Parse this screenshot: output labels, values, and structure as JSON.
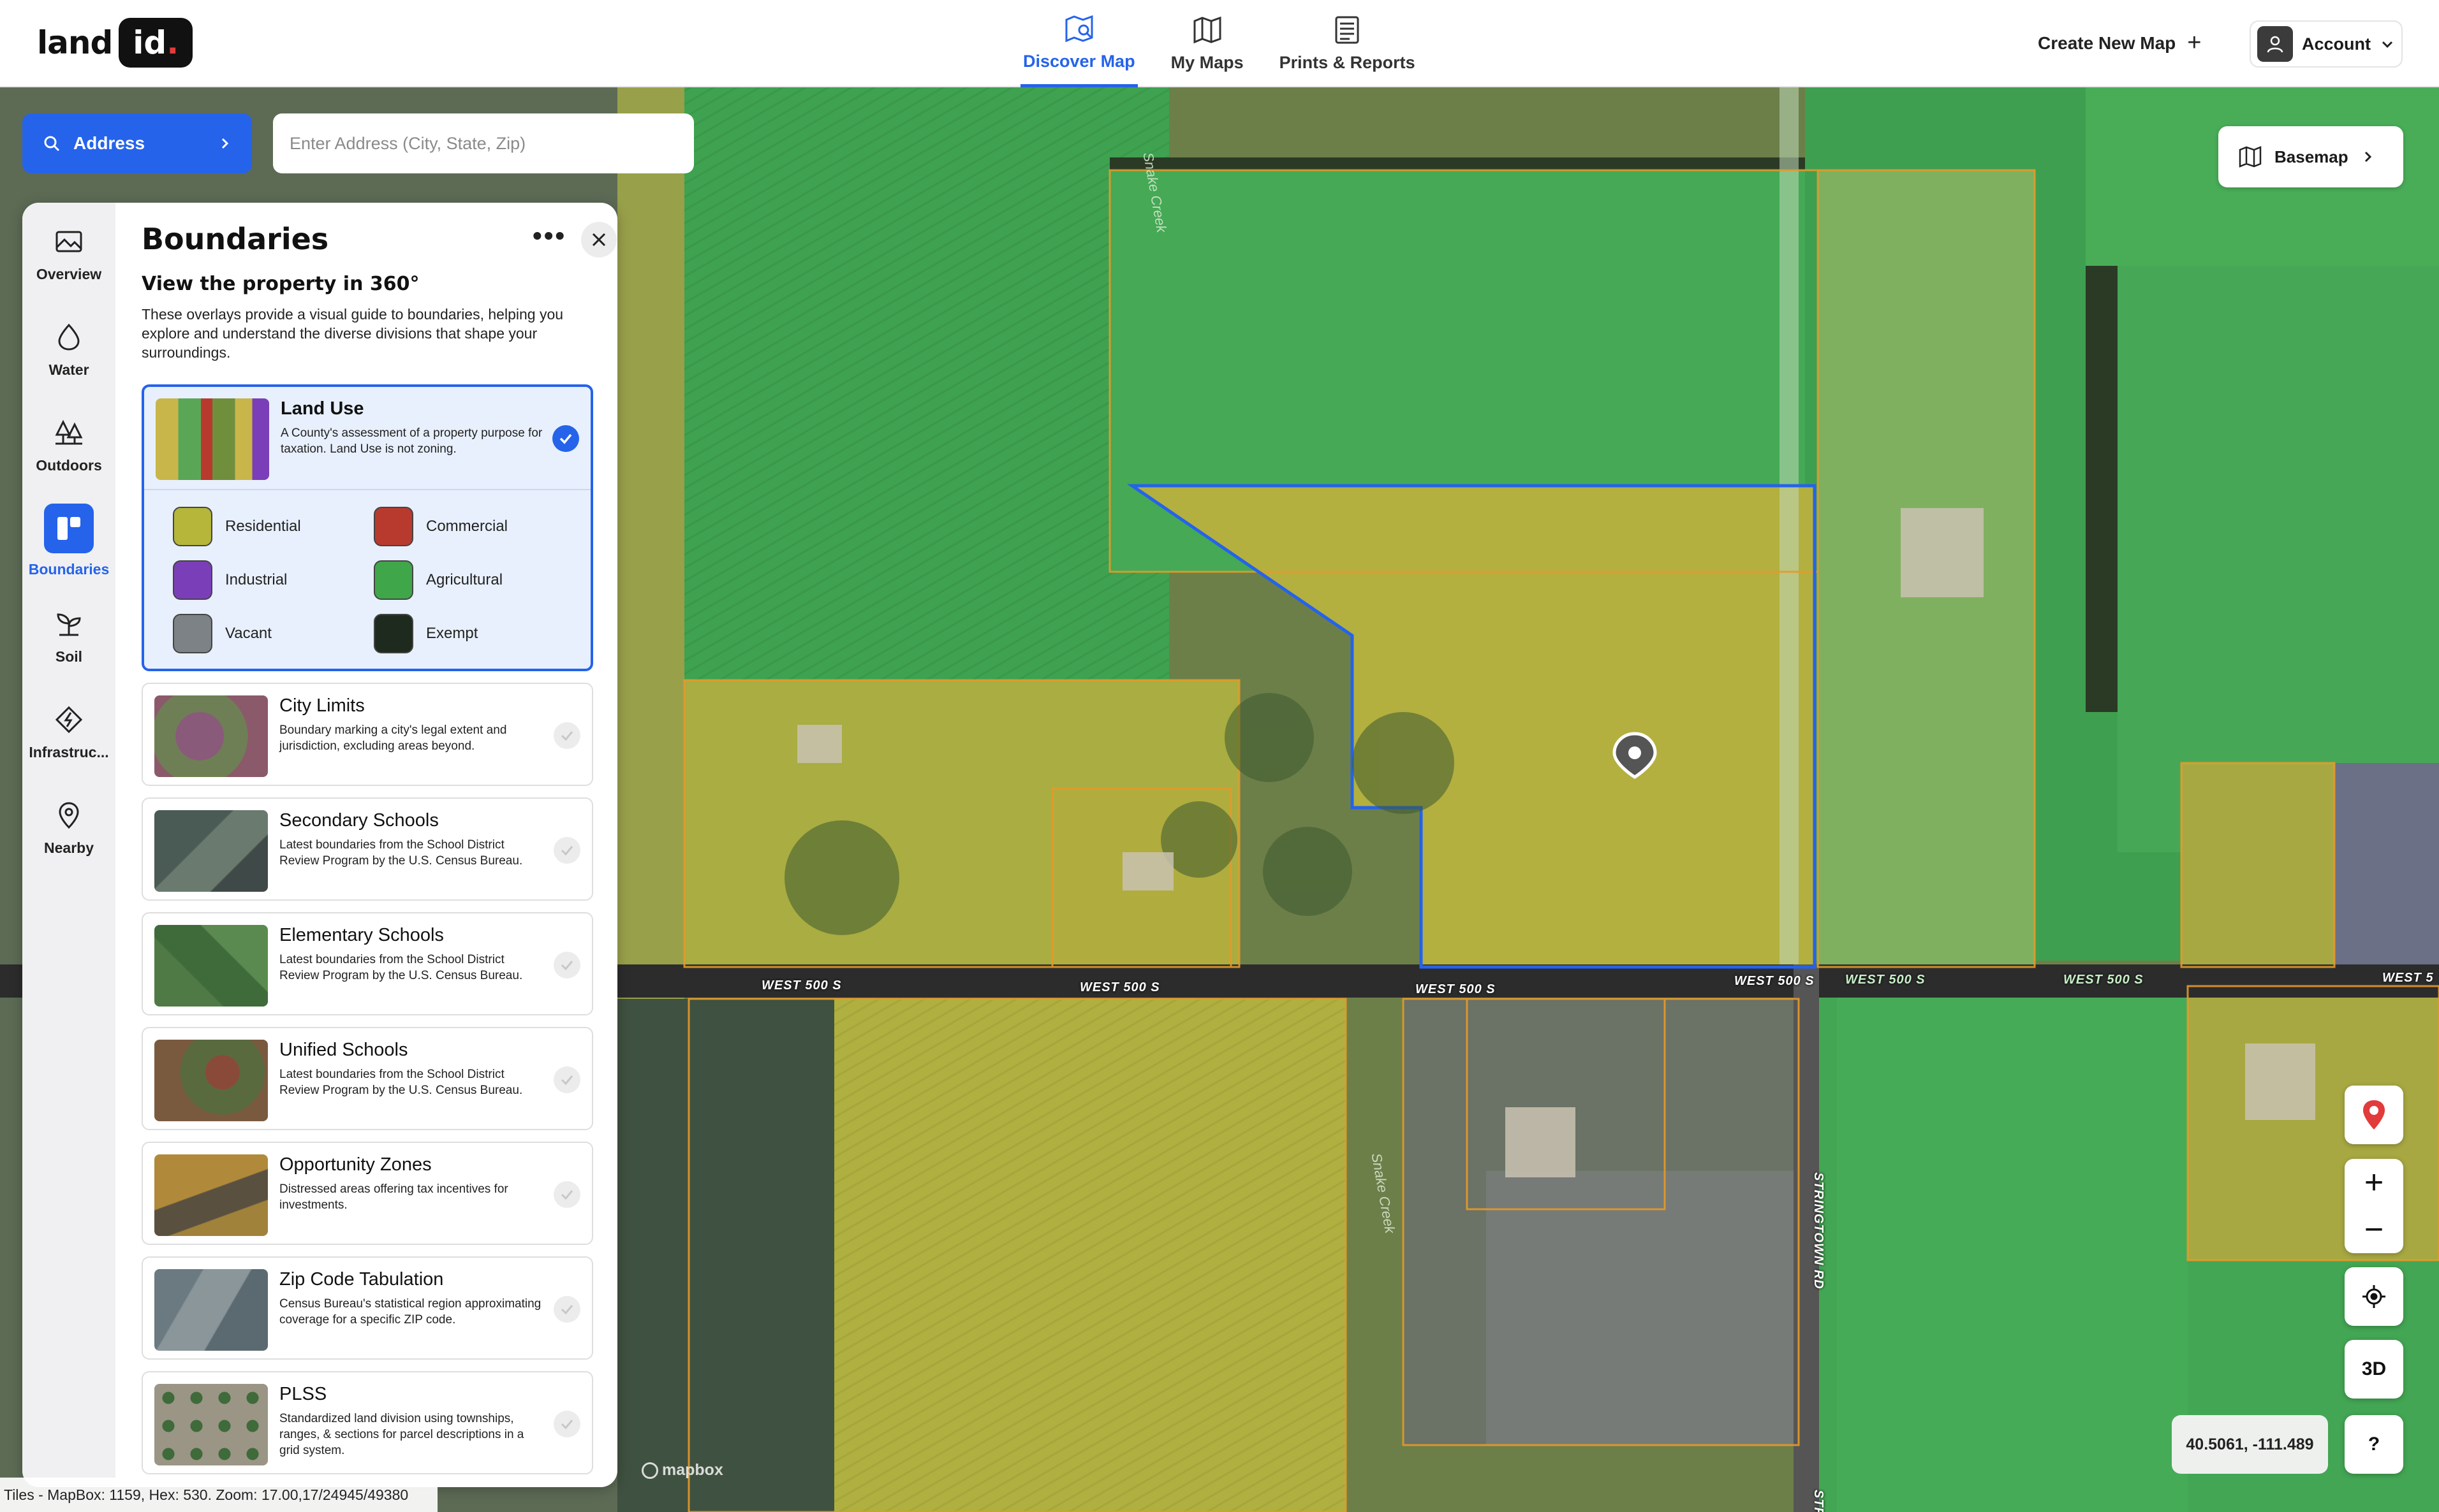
{
  "app": {
    "logo_text": "land",
    "logo_box": "id",
    "logo_dot": "."
  },
  "nav": [
    {
      "label": "Discover Map",
      "icon": "map-search-icon",
      "active": true
    },
    {
      "label": "My Maps",
      "icon": "folded-map-icon",
      "active": false
    },
    {
      "label": "Prints & Reports",
      "icon": "report-icon",
      "active": false
    }
  ],
  "header": {
    "create_map": "Create New Map",
    "account": "Account"
  },
  "search": {
    "mode_label": "Address",
    "placeholder": "Enter Address (City, State, Zip)"
  },
  "rail": [
    {
      "label": "Overview",
      "icon": "landscape-icon"
    },
    {
      "label": "Water",
      "icon": "water-drop-icon"
    },
    {
      "label": "Outdoors",
      "icon": "trees-icon"
    },
    {
      "label": "Boundaries",
      "icon": "boundaries-icon",
      "active": true
    },
    {
      "label": "Soil",
      "icon": "sprout-icon"
    },
    {
      "label": "Infrastruc...",
      "icon": "infrastructure-icon"
    },
    {
      "label": "Nearby",
      "icon": "location-pin-icon"
    }
  ],
  "panel": {
    "title": "Boundaries",
    "subtitle": "View the property in 360°",
    "description": "These overlays provide a visual guide to boundaries, helping you explore and understand the diverse divisions that shape your surroundings."
  },
  "layers": [
    {
      "title": "Land Use",
      "desc": "A County's assessment of a property purpose for taxation. Land Use is not zoning.",
      "selected": true
    },
    {
      "title": "City Limits",
      "desc": "Boundary marking a city's legal extent and jurisdiction, excluding areas beyond."
    },
    {
      "title": "Secondary Schools",
      "desc": "Latest boundaries from the School District Review Program by the U.S. Census Bureau."
    },
    {
      "title": "Elementary Schools",
      "desc": "Latest boundaries from the School District Review Program by the U.S. Census Bureau."
    },
    {
      "title": "Unified Schools",
      "desc": "Latest boundaries from the School District Review Program by the U.S. Census Bureau."
    },
    {
      "title": "Opportunity Zones",
      "desc": "Distressed areas offering tax incentives for investments."
    },
    {
      "title": "Zip Code Tabulation",
      "desc": "Census Bureau's statistical region approximating coverage for a specific ZIP code."
    },
    {
      "title": "PLSS",
      "desc": "Standardized land division using townships, ranges, & sections for parcel descriptions in a grid system."
    }
  ],
  "legend": [
    {
      "label": "Residential",
      "color": "#b5b63a"
    },
    {
      "label": "Commercial",
      "color": "#b83a2e"
    },
    {
      "label": "Industrial",
      "color": "#7a3fb8"
    },
    {
      "label": "Agricultural",
      "color": "#3fa64a"
    },
    {
      "label": "Vacant",
      "color": "#7c8285"
    },
    {
      "label": "Exempt",
      "color": "#1f2a1f"
    }
  ],
  "map": {
    "basemap_label": "Basemap",
    "coordinates": "40.5061, -111.489",
    "tiles_info": "Tiles - MapBox: 1159, Hex: 530. Zoom: 17.00,17/24945/49380",
    "attribution": "mapbox",
    "three_d": "3D",
    "help": "?",
    "roads": [
      "WEST 500 S",
      "WEST 500 S",
      "WEST 500 S",
      "WEST 500 S",
      "WEST 500 S",
      "WEST 500 S",
      "WEST 5"
    ],
    "road_vertical": "STRINGTOWN RD",
    "road_vertical_2": "STRI",
    "creek": [
      "Snake Creek",
      "Snake Creek"
    ]
  }
}
